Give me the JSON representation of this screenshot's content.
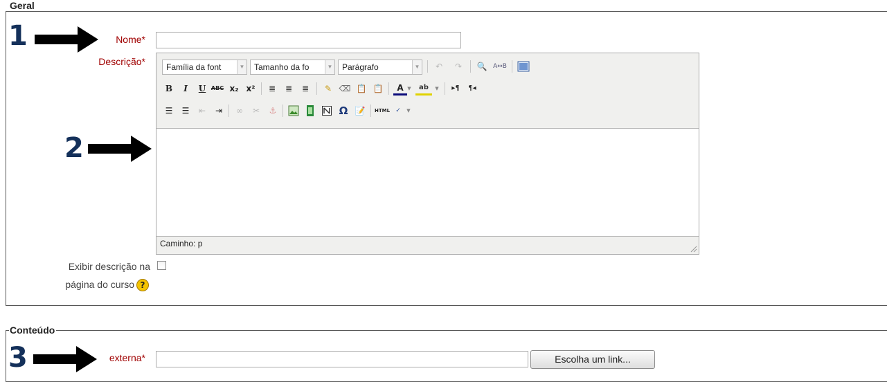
{
  "sections": {
    "geral": {
      "legend": "Geral"
    },
    "conteudo": {
      "legend": "Conteúdo"
    }
  },
  "fields": {
    "nome": {
      "label": "Nome",
      "required": "*",
      "value": ""
    },
    "descricao": {
      "label": "Descrição",
      "required": "*"
    },
    "exibir": {
      "label_line1": "Exibir descrição na",
      "label_line2": "página do curso",
      "checked": false,
      "help_icon": "help-icon"
    },
    "url": {
      "label": "externa",
      "required": "*",
      "value": "",
      "button": "Escolha um link..."
    }
  },
  "editor": {
    "font_family": "Família da font",
    "font_size": "Tamanho da fo",
    "format": "Parágrafo",
    "path": "Caminho: p",
    "toolbar_row1_icons": [
      "undo-icon",
      "redo-icon",
      "find-icon",
      "replace-icon",
      "fullscreen-icon"
    ],
    "toolbar_row2_icons": [
      "bold-icon",
      "italic-icon",
      "underline-icon",
      "strikethrough-icon",
      "subscript-icon",
      "superscript-icon",
      "align-left-icon",
      "align-center-icon",
      "align-right-icon",
      "cleanup-icon",
      "eraser-icon",
      "paste-text-icon",
      "paste-word-icon",
      "text-color-icon",
      "highlight-icon",
      "ltr-icon",
      "rtl-icon"
    ],
    "toolbar_row3_icons": [
      "unordered-list-icon",
      "ordered-list-icon",
      "outdent-icon",
      "indent-icon",
      "link-icon",
      "unlink-icon",
      "anchor-icon",
      "image-icon",
      "media-icon",
      "nolink-icon",
      "charmap-icon",
      "edit-icon",
      "html-icon",
      "spellcheck-icon"
    ]
  },
  "markers": [
    "1",
    "2",
    "3"
  ],
  "colors": {
    "required_label": "#a00000",
    "marker": "#14305a"
  }
}
